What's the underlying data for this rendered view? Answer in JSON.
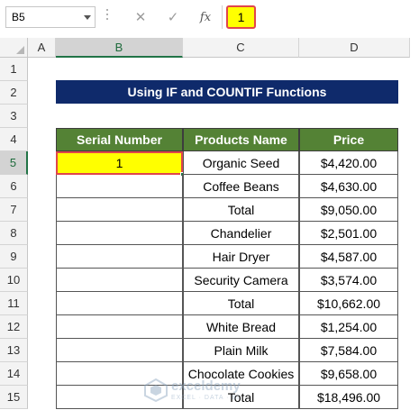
{
  "formula_bar": {
    "name_box": "B5",
    "cancel_icon": "close-icon",
    "enter_icon": "check-icon",
    "fx_label": "fx",
    "value": "1"
  },
  "columns": [
    "A",
    "B",
    "C",
    "D"
  ],
  "rows": [
    "1",
    "2",
    "3",
    "4",
    "5",
    "6",
    "7",
    "8",
    "9",
    "10",
    "11",
    "12",
    "13",
    "14",
    "15"
  ],
  "selected_cell": "B5",
  "sheet": {
    "title": "Using IF and COUNTIF Functions",
    "headers": {
      "serial": "Serial Number",
      "product": "Products Name",
      "price": "Price"
    },
    "data": [
      {
        "serial": "1",
        "product": "Organic Seed",
        "price": "$4,420.00"
      },
      {
        "serial": "",
        "product": "Coffee Beans",
        "price": "$4,630.00"
      },
      {
        "serial": "",
        "product": "Total",
        "price": "$9,050.00"
      },
      {
        "serial": "",
        "product": "Chandelier",
        "price": "$2,501.00"
      },
      {
        "serial": "",
        "product": "Hair Dryer",
        "price": "$4,587.00"
      },
      {
        "serial": "",
        "product": "Security Camera",
        "price": "$3,574.00"
      },
      {
        "serial": "",
        "product": "Total",
        "price": "$10,662.00"
      },
      {
        "serial": "",
        "product": "White Bread",
        "price": "$1,254.00"
      },
      {
        "serial": "",
        "product": "Plain Milk",
        "price": "$7,584.00"
      },
      {
        "serial": "",
        "product": "Chocolate Cookies",
        "price": "$9,658.00"
      },
      {
        "serial": "",
        "product": "Total",
        "price": "$18,496.00"
      }
    ]
  },
  "watermark": {
    "name": "exceldemy",
    "tagline": "EXCEL · DATA · BI"
  },
  "colors": {
    "title_bg": "#0f2a6b",
    "header_bg": "#548235",
    "highlight": "#ffff00",
    "highlight_border": "#e0464b"
  }
}
